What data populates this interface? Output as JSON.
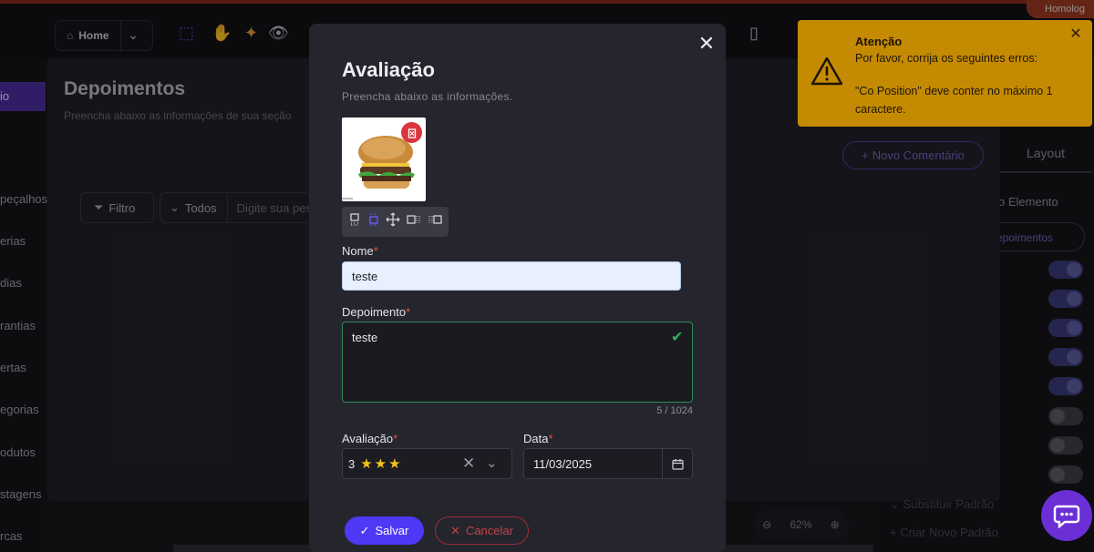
{
  "topbar": {
    "home_label": "Home",
    "env_badge": "Homolog"
  },
  "left_nav": [
    "io",
    "peçalhos",
    "erias",
    "dias",
    "rantias",
    "ertas",
    "egorias",
    "odutos",
    "stagens",
    "rcas"
  ],
  "backdrop": {
    "title": "Depoimentos",
    "subtitle": "Preencha abaixo as informações de sua seção",
    "filter_label": "Filtro",
    "scope_label": "Todos",
    "search_placeholder": "Digite sua pes",
    "new_comment_label": "Novo Comentário",
    "layout_tab": "Layout",
    "elemento_label": "o Elemento",
    "pill_label": "epoimentos",
    "substituir_label": "Substituir Padrão",
    "criar_label": "Criar Novo Padrão",
    "zoom_value": "62%"
  },
  "modal": {
    "title": "Avaliação",
    "subtitle": "Preencha abaixo as informações.",
    "nome_label": "Nome",
    "nome_value": "teste",
    "depoimento_label": "Depoimento",
    "depoimento_value": "teste",
    "char_count": "5 / 1024",
    "avaliacao_label": "Avaliação",
    "avaliacao_value": "3",
    "avaliacao_stars": "★★★",
    "data_label": "Data",
    "data_value": "11/03/2025",
    "save_label": "Salvar",
    "cancel_label": "Cancelar",
    "required_mark": "*"
  },
  "toast": {
    "title": "Atenção",
    "line1": "Por favor, corrija os seguintes erros:",
    "line2": "\"Co Position\" deve conter no máximo 1 caractere."
  },
  "colors": {
    "accent": "#4f39f6",
    "toast_bg": "#c48a02",
    "danger": "#d9363e",
    "success": "#2fae65"
  }
}
